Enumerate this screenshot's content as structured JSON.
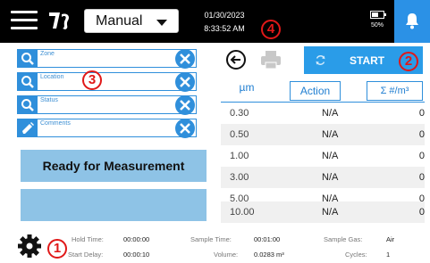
{
  "header": {
    "mode": "Manual",
    "date": "01/30/2023",
    "time": "8:33:52 AM",
    "battery_percent": "50%"
  },
  "badges": {
    "b1": "1",
    "b2": "2",
    "b3": "3",
    "b4": "4"
  },
  "fields": [
    {
      "placeholder": "Zone",
      "icon": "search-icon"
    },
    {
      "placeholder": "Location",
      "icon": "search-icon"
    },
    {
      "placeholder": "Status",
      "icon": "search-icon"
    },
    {
      "placeholder": "Comments",
      "icon": "pencil-icon"
    }
  ],
  "ready_label": "Ready for Measurement",
  "start_label": "START",
  "table": {
    "headers": {
      "size": "µm",
      "action": "Action",
      "count": "Σ #/m³"
    },
    "rows": [
      {
        "size": "0.30",
        "action": "N/A",
        "count": "0"
      },
      {
        "size": "0.50",
        "action": "N/A",
        "count": "0"
      },
      {
        "size": "1.00",
        "action": "N/A",
        "count": "0"
      },
      {
        "size": "3.00",
        "action": "N/A",
        "count": "0"
      },
      {
        "size": "5.00",
        "action": "N/A",
        "count": "0"
      },
      {
        "size": "10.00",
        "action": "N/A",
        "count": "0"
      }
    ]
  },
  "footer": {
    "hold_time_label": "Hold Time:",
    "hold_time": "00:00:00",
    "start_delay_label": "Start Delay:",
    "start_delay": "00:00:10",
    "sample_time_label": "Sample Time:",
    "sample_time": "00:01:00",
    "volume_label": "Volume:",
    "volume": "0.0283 m³",
    "sample_gas_label": "Sample Gas:",
    "sample_gas": "Air",
    "cycles_label": "Cycles:",
    "cycles": "1"
  },
  "colors": {
    "accent": "#2f8fdb",
    "start": "#2a9ce8",
    "ready": "#8ec3e6",
    "badge": "#e01818"
  }
}
